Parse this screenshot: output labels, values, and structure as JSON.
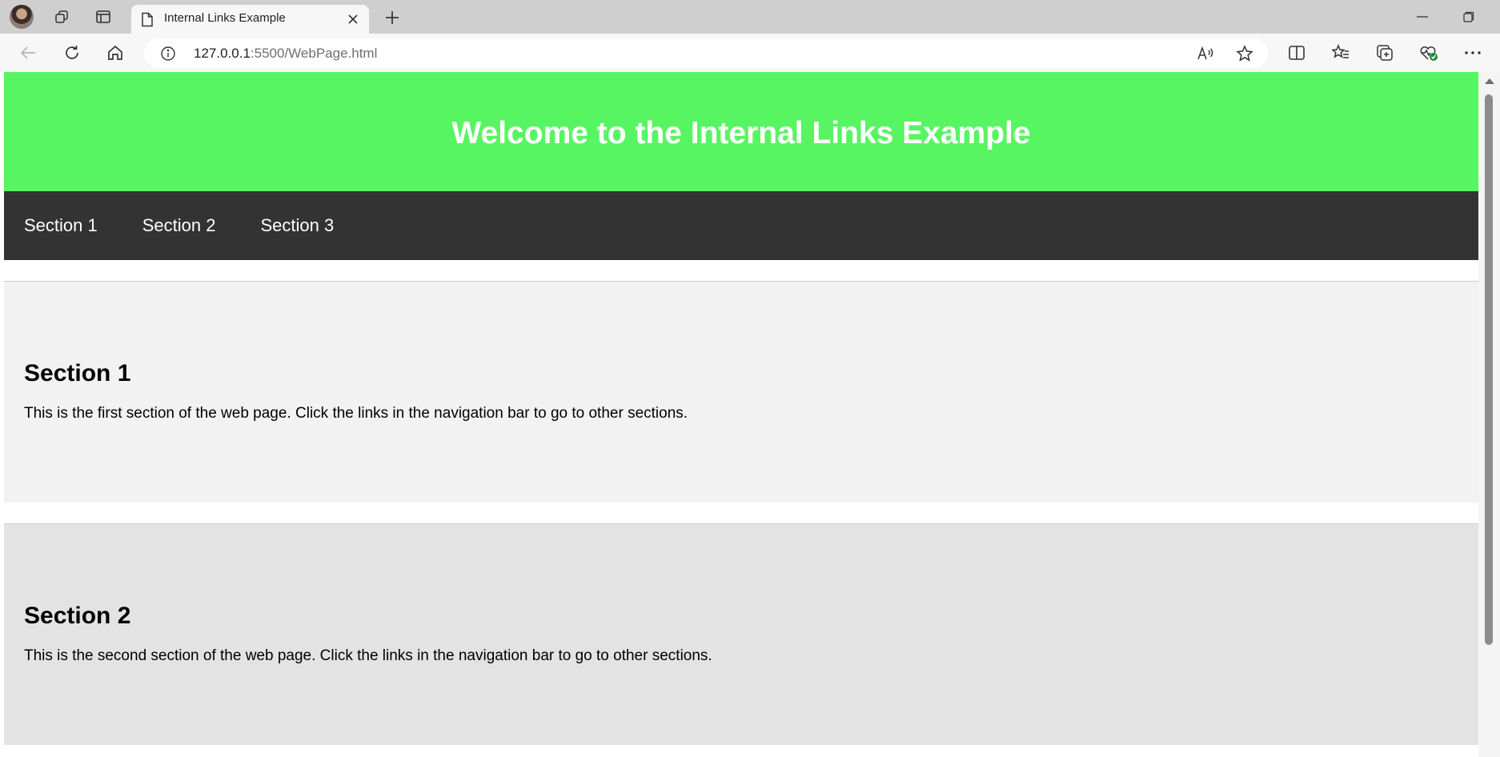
{
  "browser": {
    "tab_title": "Internal Links Example",
    "url_host": "127.0.0.1",
    "url_rest": ":5500/WebPage.html"
  },
  "page": {
    "header_title": "Welcome to the Internal Links Example",
    "nav": [
      "Section 1",
      "Section 2",
      "Section 3"
    ],
    "sections": [
      {
        "heading": "Section 1",
        "text": "This is the first section of the web page. Click the links in the navigation bar to go to other sections."
      },
      {
        "heading": "Section 2",
        "text": "This is the second section of the web page. Click the links in the navigation bar to go to other sections."
      }
    ]
  },
  "colors": {
    "header_bg": "#58f562",
    "nav_bg": "#333333",
    "section1_bg": "#f2f2f2",
    "section2_bg": "#e3e3e3"
  },
  "icons": [
    "profile-avatar",
    "workspaces-icon",
    "tab-actions-icon",
    "document-icon",
    "close-icon",
    "plus-icon",
    "minimize-icon",
    "restore-icon",
    "back-arrow-icon",
    "refresh-icon",
    "home-icon",
    "info-icon",
    "read-aloud-icon",
    "favorite-star-icon",
    "split-screen-icon",
    "favorites-icon",
    "collections-icon",
    "browser-essentials-icon",
    "more-icon"
  ]
}
